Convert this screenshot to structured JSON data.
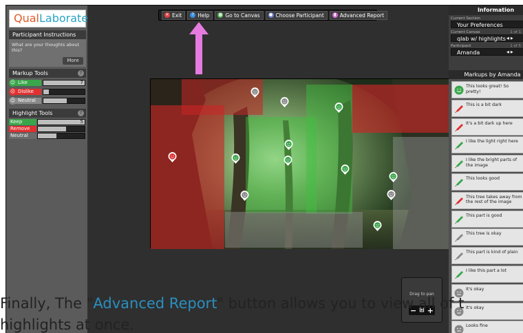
{
  "logo": {
    "part1": "Qual",
    "part2": "Laborate"
  },
  "instructions": {
    "header": "Participant Instructions",
    "text": "What are your thoughts about this?",
    "more_label": "More"
  },
  "markup_tools": {
    "header": "Markup Tools",
    "help": "?",
    "items": [
      {
        "label": "Like",
        "count": "7",
        "fraction": 1.0,
        "color": "#3aa64a"
      },
      {
        "label": "Dislike",
        "count": "1",
        "fraction": 0.14,
        "color": "#e03030"
      },
      {
        "label": "Neutral",
        "count": "4",
        "fraction": 0.57,
        "color": "#8a8a8a"
      }
    ]
  },
  "highlight_tools": {
    "header": "Highlight Tools",
    "help": "?",
    "items": [
      {
        "label": "Keep",
        "count": "5",
        "fraction": 1.0,
        "color": "#3aa64a"
      },
      {
        "label": "Remove",
        "count": "3",
        "fraction": 0.6,
        "color": "#e03030"
      },
      {
        "label": "Neutral",
        "count": "2",
        "fraction": 0.4,
        "color": "#6a6a6a"
      }
    ]
  },
  "toolbar": {
    "buttons": [
      {
        "label": "Exit",
        "icon": "exit-icon"
      },
      {
        "label": "Help",
        "icon": "help-icon"
      },
      {
        "label": "Go to Canvas",
        "icon": "canvas-icon"
      },
      {
        "label": "Choose Participant",
        "icon": "participant-icon"
      },
      {
        "label": "Advanced Report",
        "icon": "report-icon"
      }
    ]
  },
  "info": {
    "header": "Information",
    "current_section_label": "Current Section",
    "current_section": "Your Preferences",
    "current_canvas_label": "Current Canvas",
    "current_canvas": "qlab w/ highlights",
    "canvas_count": "1 of 1",
    "participant_label": "Participant",
    "participant": "Amanda",
    "participant_count": "1 of 5"
  },
  "markups_header": "Markups by Amanda",
  "markups": [
    {
      "text": "This looks great! So pretty!",
      "kind": "like-face"
    },
    {
      "text": "This is a bit dark",
      "kind": "remove-pen"
    },
    {
      "text": "It's a bit dark up here",
      "kind": "remove-pen"
    },
    {
      "text": "I like the light right here",
      "kind": "keep-pen"
    },
    {
      "text": "I like the bright parts of the image",
      "kind": "keep-pen"
    },
    {
      "text": "This looks good",
      "kind": "keep-pen"
    },
    {
      "text": "This tree takes away from the rest of the image",
      "kind": "remove-pen"
    },
    {
      "text": "This part is good",
      "kind": "keep-pen"
    },
    {
      "text": "This tree is okay",
      "kind": "neutral-pen"
    },
    {
      "text": "This part is kind of plain",
      "kind": "neutral-pen"
    },
    {
      "text": "I like this part a lot",
      "kind": "keep-pen"
    },
    {
      "text": "It's okay",
      "kind": "neutral-face"
    },
    {
      "text": "It's okay",
      "kind": "neutral-face"
    },
    {
      "text": "Looks fine",
      "kind": "neutral-face"
    }
  ],
  "zoom": {
    "label": "Drag to pan",
    "minus": "−",
    "fit": "⊞",
    "plus": "+"
  },
  "caption": {
    "line1_pre": "Finally, The \"",
    "line1_link": "Advanced Report",
    "line1_post": "\" button allows you to view all of t",
    "line2": "highlights at once."
  }
}
